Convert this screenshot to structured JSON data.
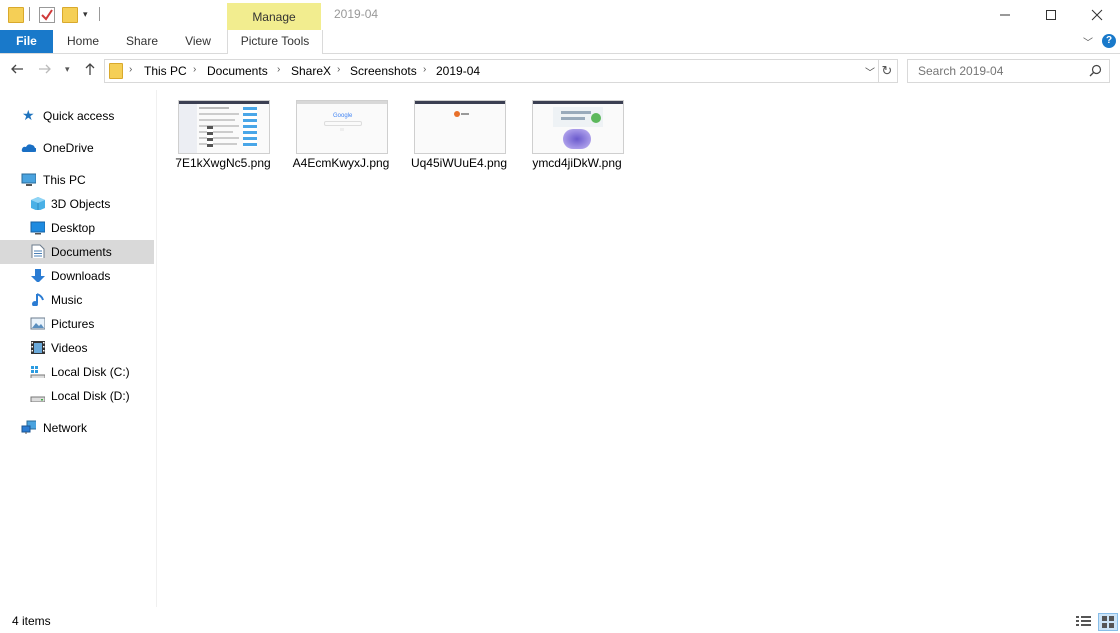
{
  "window": {
    "title": "2019-04",
    "contextual_tab": "Manage",
    "controls": {
      "minimize": "—",
      "maximize": "☐",
      "close": "✕"
    }
  },
  "ribbon": {
    "tabs": [
      "File",
      "Home",
      "Share",
      "View",
      "Picture Tools"
    ]
  },
  "address": {
    "path": [
      "This PC",
      "Documents",
      "ShareX",
      "Screenshots",
      "2019-04"
    ]
  },
  "search": {
    "placeholder": "Search 2019-04"
  },
  "nav": {
    "items": [
      {
        "label": "Quick access",
        "icon": "star-icon"
      },
      {
        "label": "OneDrive",
        "icon": "cloud-icon"
      },
      {
        "label": "This PC",
        "icon": "monitor-icon"
      },
      {
        "label": "3D Objects",
        "icon": "cube-icon"
      },
      {
        "label": "Desktop",
        "icon": "desktop-icon"
      },
      {
        "label": "Documents",
        "icon": "document-icon",
        "selected": true
      },
      {
        "label": "Downloads",
        "icon": "download-icon"
      },
      {
        "label": "Music",
        "icon": "music-icon"
      },
      {
        "label": "Pictures",
        "icon": "picture-icon"
      },
      {
        "label": "Videos",
        "icon": "video-icon"
      },
      {
        "label": "Local Disk (C:)",
        "icon": "disk-c-icon"
      },
      {
        "label": "Local Disk (D:)",
        "icon": "disk-d-icon"
      },
      {
        "label": "Network",
        "icon": "network-icon"
      }
    ]
  },
  "files": [
    {
      "name": "7E1kXwgNc5.png"
    },
    {
      "name": "A4EcmKwyxJ.png"
    },
    {
      "name": "Uq45iWUuE4.png"
    },
    {
      "name": "ymcd4jiDkW.png"
    }
  ],
  "status": {
    "count": "4 items"
  },
  "colors": {
    "accent": "#1979ca",
    "manage": "#f2ed8f",
    "selected": "#d9d9d9"
  }
}
